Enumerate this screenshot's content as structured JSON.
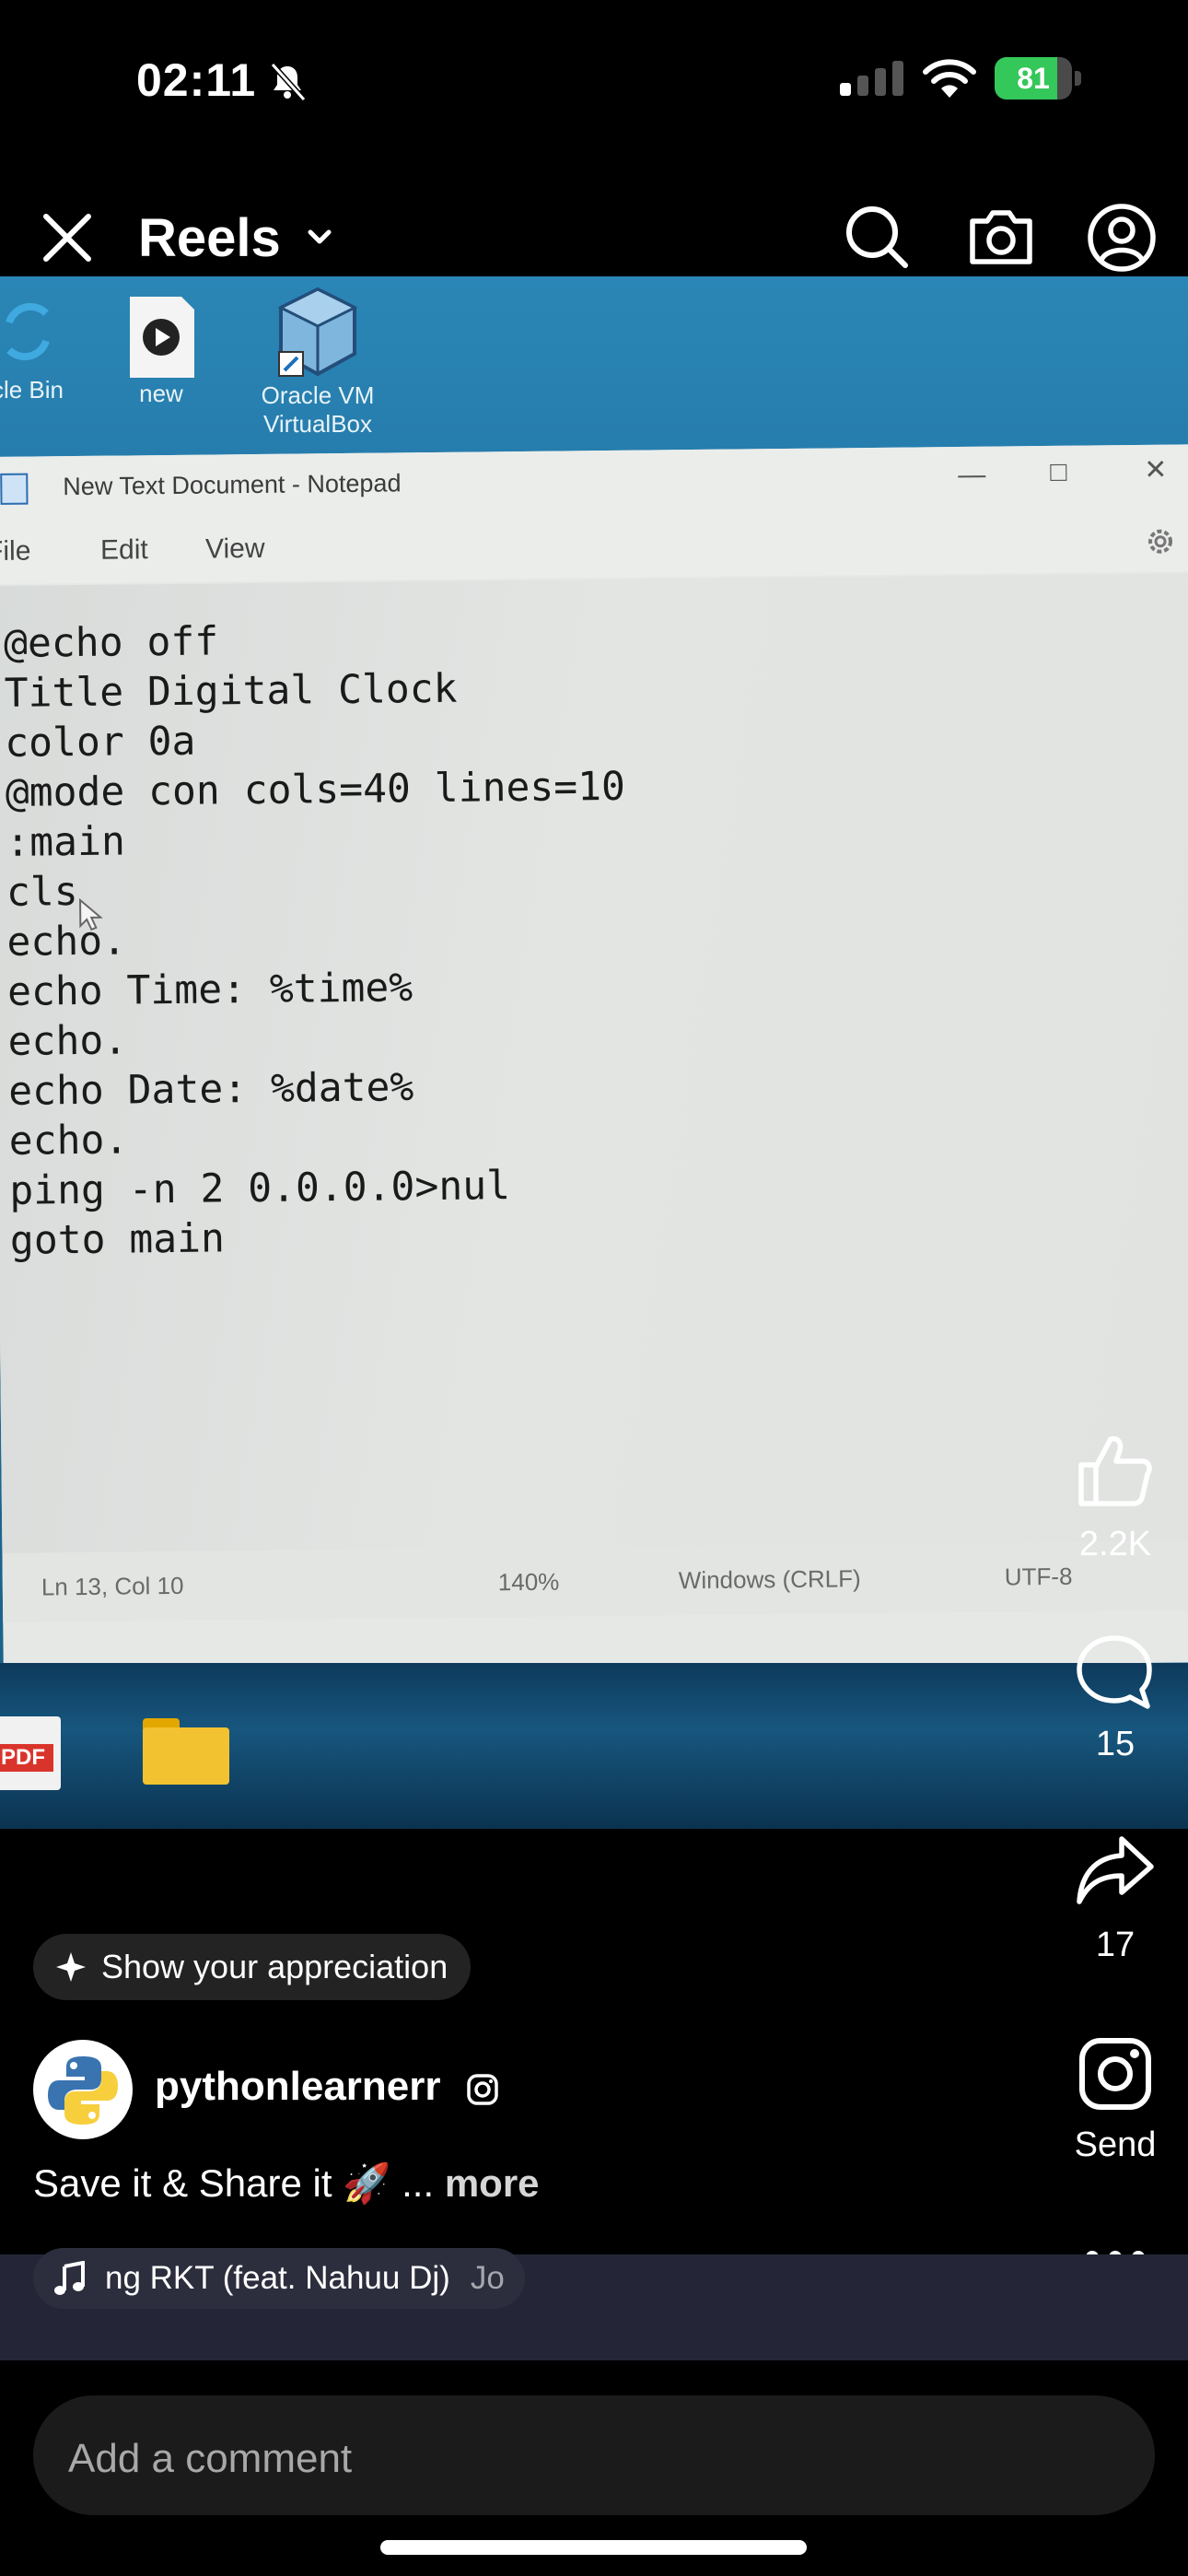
{
  "status_bar": {
    "time": "02:11",
    "battery": "81",
    "battery_fraction": 0.81
  },
  "nav": {
    "title": "Reels"
  },
  "video": {
    "desktop_icons": [
      {
        "label": "cle Bin"
      },
      {
        "label": "new"
      },
      {
        "label_line1": "Oracle VM",
        "label_line2": "VirtualBox"
      }
    ],
    "notepad": {
      "title": "New Text Document - Notepad",
      "menu": [
        "File",
        "Edit",
        "View"
      ],
      "code_lines": [
        "@echo off",
        "Title Digital Clock",
        "color 0a",
        "@mode con cols=40 lines=10",
        ":main",
        "cls",
        "echo.",
        "echo Time: %time%",
        "echo.",
        "echo Date: %date%",
        "echo.",
        "ping -n 2 0.0.0.0>nul",
        "goto main"
      ],
      "status": {
        "position": "Ln 13, Col 10",
        "zoom": "140%",
        "line_ending": "Windows (CRLF)",
        "encoding": "UTF-8"
      }
    },
    "taskbar_icons": {
      "pdf_label": "PDF"
    }
  },
  "actions": {
    "like_count": "2.2K",
    "comment_count": "15",
    "share_count": "17",
    "send_label": "Send"
  },
  "post": {
    "appreciation_label": "Show your appreciation",
    "username": "pythonlearnerr",
    "caption": "Save it & Share it 🚀 ... ",
    "caption_more": "more",
    "music_title": "ng RKT (feat. Nahuu Dj)",
    "music_next": "Jo"
  },
  "comment": {
    "placeholder": "Add a comment"
  },
  "colors": {
    "battery_green": "#34c759",
    "background": "#000000",
    "music_band": "#242638"
  }
}
